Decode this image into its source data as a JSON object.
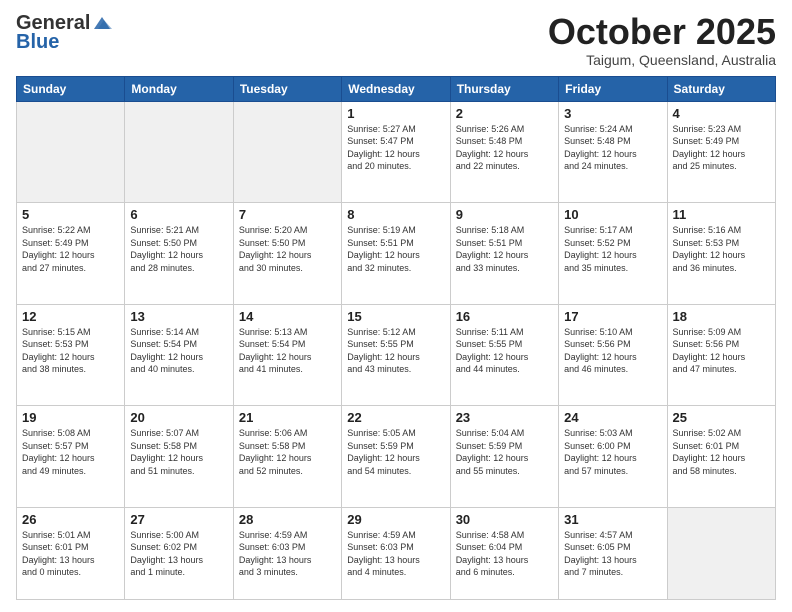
{
  "header": {
    "logo_general": "General",
    "logo_blue": "Blue",
    "month_title": "October 2025",
    "location": "Taigum, Queensland, Australia"
  },
  "weekdays": [
    "Sunday",
    "Monday",
    "Tuesday",
    "Wednesday",
    "Thursday",
    "Friday",
    "Saturday"
  ],
  "weeks": [
    [
      {
        "day": "",
        "info": ""
      },
      {
        "day": "",
        "info": ""
      },
      {
        "day": "",
        "info": ""
      },
      {
        "day": "1",
        "info": "Sunrise: 5:27 AM\nSunset: 5:47 PM\nDaylight: 12 hours\nand 20 minutes."
      },
      {
        "day": "2",
        "info": "Sunrise: 5:26 AM\nSunset: 5:48 PM\nDaylight: 12 hours\nand 22 minutes."
      },
      {
        "day": "3",
        "info": "Sunrise: 5:24 AM\nSunset: 5:48 PM\nDaylight: 12 hours\nand 24 minutes."
      },
      {
        "day": "4",
        "info": "Sunrise: 5:23 AM\nSunset: 5:49 PM\nDaylight: 12 hours\nand 25 minutes."
      }
    ],
    [
      {
        "day": "5",
        "info": "Sunrise: 5:22 AM\nSunset: 5:49 PM\nDaylight: 12 hours\nand 27 minutes."
      },
      {
        "day": "6",
        "info": "Sunrise: 5:21 AM\nSunset: 5:50 PM\nDaylight: 12 hours\nand 28 minutes."
      },
      {
        "day": "7",
        "info": "Sunrise: 5:20 AM\nSunset: 5:50 PM\nDaylight: 12 hours\nand 30 minutes."
      },
      {
        "day": "8",
        "info": "Sunrise: 5:19 AM\nSunset: 5:51 PM\nDaylight: 12 hours\nand 32 minutes."
      },
      {
        "day": "9",
        "info": "Sunrise: 5:18 AM\nSunset: 5:51 PM\nDaylight: 12 hours\nand 33 minutes."
      },
      {
        "day": "10",
        "info": "Sunrise: 5:17 AM\nSunset: 5:52 PM\nDaylight: 12 hours\nand 35 minutes."
      },
      {
        "day": "11",
        "info": "Sunrise: 5:16 AM\nSunset: 5:53 PM\nDaylight: 12 hours\nand 36 minutes."
      }
    ],
    [
      {
        "day": "12",
        "info": "Sunrise: 5:15 AM\nSunset: 5:53 PM\nDaylight: 12 hours\nand 38 minutes."
      },
      {
        "day": "13",
        "info": "Sunrise: 5:14 AM\nSunset: 5:54 PM\nDaylight: 12 hours\nand 40 minutes."
      },
      {
        "day": "14",
        "info": "Sunrise: 5:13 AM\nSunset: 5:54 PM\nDaylight: 12 hours\nand 41 minutes."
      },
      {
        "day": "15",
        "info": "Sunrise: 5:12 AM\nSunset: 5:55 PM\nDaylight: 12 hours\nand 43 minutes."
      },
      {
        "day": "16",
        "info": "Sunrise: 5:11 AM\nSunset: 5:55 PM\nDaylight: 12 hours\nand 44 minutes."
      },
      {
        "day": "17",
        "info": "Sunrise: 5:10 AM\nSunset: 5:56 PM\nDaylight: 12 hours\nand 46 minutes."
      },
      {
        "day": "18",
        "info": "Sunrise: 5:09 AM\nSunset: 5:56 PM\nDaylight: 12 hours\nand 47 minutes."
      }
    ],
    [
      {
        "day": "19",
        "info": "Sunrise: 5:08 AM\nSunset: 5:57 PM\nDaylight: 12 hours\nand 49 minutes."
      },
      {
        "day": "20",
        "info": "Sunrise: 5:07 AM\nSunset: 5:58 PM\nDaylight: 12 hours\nand 51 minutes."
      },
      {
        "day": "21",
        "info": "Sunrise: 5:06 AM\nSunset: 5:58 PM\nDaylight: 12 hours\nand 52 minutes."
      },
      {
        "day": "22",
        "info": "Sunrise: 5:05 AM\nSunset: 5:59 PM\nDaylight: 12 hours\nand 54 minutes."
      },
      {
        "day": "23",
        "info": "Sunrise: 5:04 AM\nSunset: 5:59 PM\nDaylight: 12 hours\nand 55 minutes."
      },
      {
        "day": "24",
        "info": "Sunrise: 5:03 AM\nSunset: 6:00 PM\nDaylight: 12 hours\nand 57 minutes."
      },
      {
        "day": "25",
        "info": "Sunrise: 5:02 AM\nSunset: 6:01 PM\nDaylight: 12 hours\nand 58 minutes."
      }
    ],
    [
      {
        "day": "26",
        "info": "Sunrise: 5:01 AM\nSunset: 6:01 PM\nDaylight: 13 hours\nand 0 minutes."
      },
      {
        "day": "27",
        "info": "Sunrise: 5:00 AM\nSunset: 6:02 PM\nDaylight: 13 hours\nand 1 minute."
      },
      {
        "day": "28",
        "info": "Sunrise: 4:59 AM\nSunset: 6:03 PM\nDaylight: 13 hours\nand 3 minutes."
      },
      {
        "day": "29",
        "info": "Sunrise: 4:59 AM\nSunset: 6:03 PM\nDaylight: 13 hours\nand 4 minutes."
      },
      {
        "day": "30",
        "info": "Sunrise: 4:58 AM\nSunset: 6:04 PM\nDaylight: 13 hours\nand 6 minutes."
      },
      {
        "day": "31",
        "info": "Sunrise: 4:57 AM\nSunset: 6:05 PM\nDaylight: 13 hours\nand 7 minutes."
      },
      {
        "day": "",
        "info": ""
      }
    ]
  ]
}
